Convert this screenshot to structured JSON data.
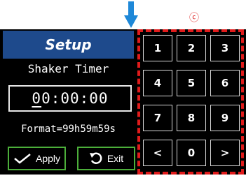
{
  "annotation": {
    "label": "ⓒ"
  },
  "screen": {
    "title": "Setup",
    "program_name": "Shaker Timer",
    "time": {
      "first_digit": "0",
      "rest": "0:00:00"
    },
    "format_text": "Format=99h59m59s",
    "apply_label": "Apply",
    "exit_label": "Exit"
  },
  "keypad": {
    "keys": [
      "1",
      "2",
      "3",
      "4",
      "5",
      "6",
      "7",
      "8",
      "9",
      "<",
      "0",
      ">"
    ]
  },
  "colors": {
    "header": "#1e4a8c",
    "button_border": "#4caf3a",
    "highlight": "#e01b1b",
    "arrow": "#1e88d8"
  }
}
